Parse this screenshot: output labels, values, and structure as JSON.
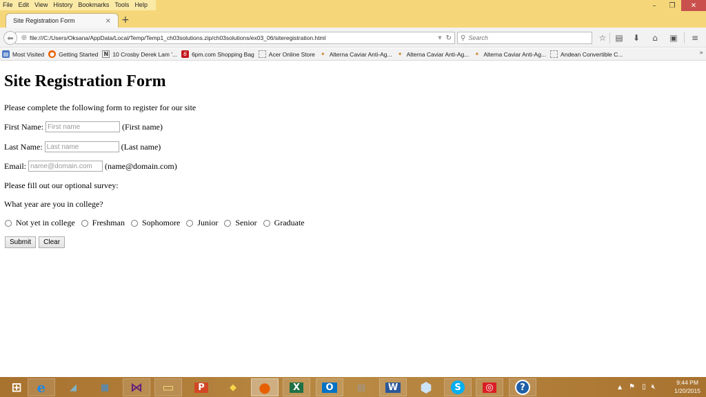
{
  "browser": {
    "menu": [
      {
        "label": "File",
        "accel": "F"
      },
      {
        "label": "Edit",
        "accel": "E"
      },
      {
        "label": "View",
        "accel": "V"
      },
      {
        "label": "History",
        "accel": "s"
      },
      {
        "label": "Bookmarks",
        "accel": "B"
      },
      {
        "label": "Tools",
        "accel": "T"
      },
      {
        "label": "Help",
        "accel": "H"
      }
    ],
    "window_controls": {
      "minimize": "–",
      "restore": "❐",
      "close": "✕"
    },
    "tab": {
      "title": "Site Registration Form",
      "close": "×"
    },
    "new_tab": "+",
    "url": "file:///C:/Users/Oksana/AppData/Local/Temp/Temp1_ch03solutions.zip/ch03solutions/ex03_06/siteregistration.html",
    "search_placeholder": "Search",
    "toolbar_icons": [
      "bookmark-star-icon",
      "reading-list-icon",
      "downloads-icon",
      "home-icon",
      "screenshot-icon",
      "menu-icon"
    ],
    "bookmarks": [
      {
        "label": "Most Visited",
        "icon": "most-visited-icon"
      },
      {
        "label": "Getting Started",
        "icon": "firefox-icon"
      },
      {
        "label": "10 Crosby Derek Lam '...",
        "icon": "n-logo-icon"
      },
      {
        "label": "6pm.com Shopping Bag",
        "icon": "6pm-icon"
      },
      {
        "label": "Acer Online Store",
        "icon": "blank-page-icon"
      },
      {
        "label": "Alterna Caviar Anti-Ag...",
        "icon": "butterfly-icon"
      },
      {
        "label": "Alterna Caviar Anti-Ag...",
        "icon": "butterfly-icon"
      },
      {
        "label": "Alterna Caviar Anti-Ag...",
        "icon": "butterfly-icon"
      },
      {
        "label": "Andean Convertible C...",
        "icon": "blank-page-icon"
      }
    ],
    "bookmarks_overflow": "»"
  },
  "page": {
    "heading": "Site Registration Form",
    "intro": "Please complete the following form to register for our site",
    "fields": [
      {
        "label": "First Name:",
        "placeholder": "First name",
        "value": "",
        "hint": "(First name)"
      },
      {
        "label": "Last Name:",
        "placeholder": "Last name",
        "value": "",
        "hint": "(Last name)"
      },
      {
        "label": "Email:",
        "placeholder": "name@domain.com",
        "value": "",
        "hint": "(name@domain.com)"
      }
    ],
    "survey_intro": "Please fill out our optional survey:",
    "question": "What year are you in college?",
    "options": [
      "Not yet in college",
      "Freshman",
      "Sophomore",
      "Junior",
      "Senior",
      "Graduate"
    ],
    "submit_label": "Submit",
    "clear_label": "Clear"
  },
  "taskbar": {
    "apps": [
      {
        "name": "start-button",
        "glyph": "⊞"
      },
      {
        "name": "internet-explorer",
        "glyph": "e"
      },
      {
        "name": "notepad-app",
        "glyph": "◢"
      },
      {
        "name": "control-panel",
        "glyph": "▦"
      },
      {
        "name": "visual-studio",
        "glyph": "⋈"
      },
      {
        "name": "file-explorer",
        "glyph": "▭"
      },
      {
        "name": "powerpoint",
        "glyph": "P"
      },
      {
        "name": "sticky-notes",
        "glyph": "◆"
      },
      {
        "name": "firefox",
        "glyph": "●"
      },
      {
        "name": "excel",
        "glyph": "X"
      },
      {
        "name": "outlook",
        "glyph": "O"
      },
      {
        "name": "firewall-app",
        "glyph": "▤"
      },
      {
        "name": "word",
        "glyph": "W"
      },
      {
        "name": "virtualbox",
        "glyph": "⬢"
      },
      {
        "name": "skype",
        "glyph": "S"
      },
      {
        "name": "creative-cloud",
        "glyph": "◎"
      },
      {
        "name": "help",
        "glyph": "?"
      }
    ],
    "time": "9:44 PM",
    "date": "1/20/2015"
  }
}
